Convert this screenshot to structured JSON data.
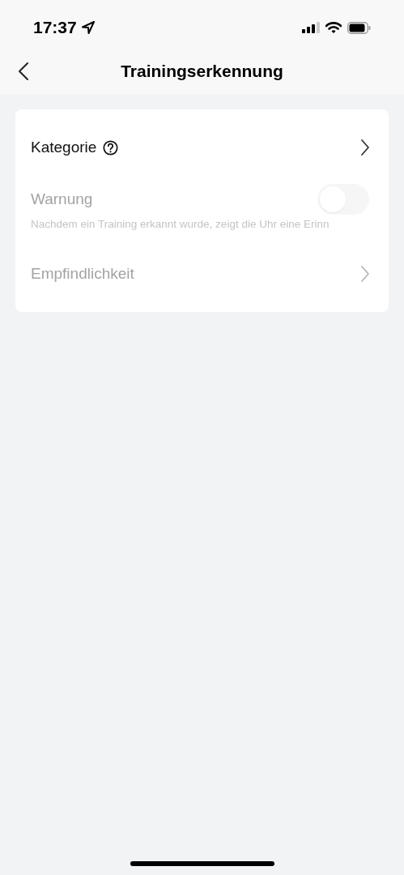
{
  "status_bar": {
    "time": "17:37"
  },
  "nav": {
    "title": "Trainingserkennung"
  },
  "settings": [
    {
      "kind": "link",
      "label": "Kategorie",
      "help": true,
      "disabled": false
    },
    {
      "kind": "toggle",
      "label": "Warnung",
      "description": "Nachdem ein Training erkannt wurde, zeigt die Uhr eine Erinn",
      "on": false,
      "disabled": true
    },
    {
      "kind": "link",
      "label": "Empfindlichkeit",
      "help": false,
      "disabled": true
    }
  ]
}
